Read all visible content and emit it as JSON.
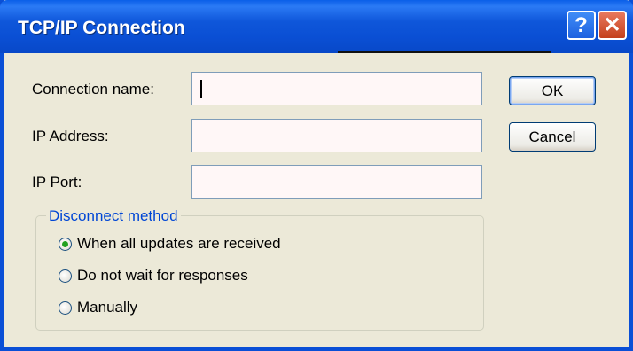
{
  "window": {
    "title": "TCP/IP Connection",
    "help_glyph": "?",
    "close_glyph": "✕"
  },
  "form": {
    "connection_name_label": "Connection name:",
    "connection_name_value": "",
    "ip_address_label": "IP Address:",
    "ip_address_value": "",
    "ip_port_label": "IP Port:",
    "ip_port_value": ""
  },
  "buttons": {
    "ok": "OK",
    "cancel": "Cancel"
  },
  "disconnect": {
    "legend": "Disconnect method",
    "options": [
      {
        "label": "When all updates are received",
        "checked": true
      },
      {
        "label": "Do not wait for responses",
        "checked": false
      },
      {
        "label": "Manually",
        "checked": false
      }
    ]
  },
  "colors": {
    "titlebar": "#0a4fd6",
    "dialog_bg": "#ece9d8",
    "group_legend": "#0046d5",
    "radio_dot": "#21a121"
  },
  "icons": [
    "help-icon",
    "close-icon"
  ]
}
